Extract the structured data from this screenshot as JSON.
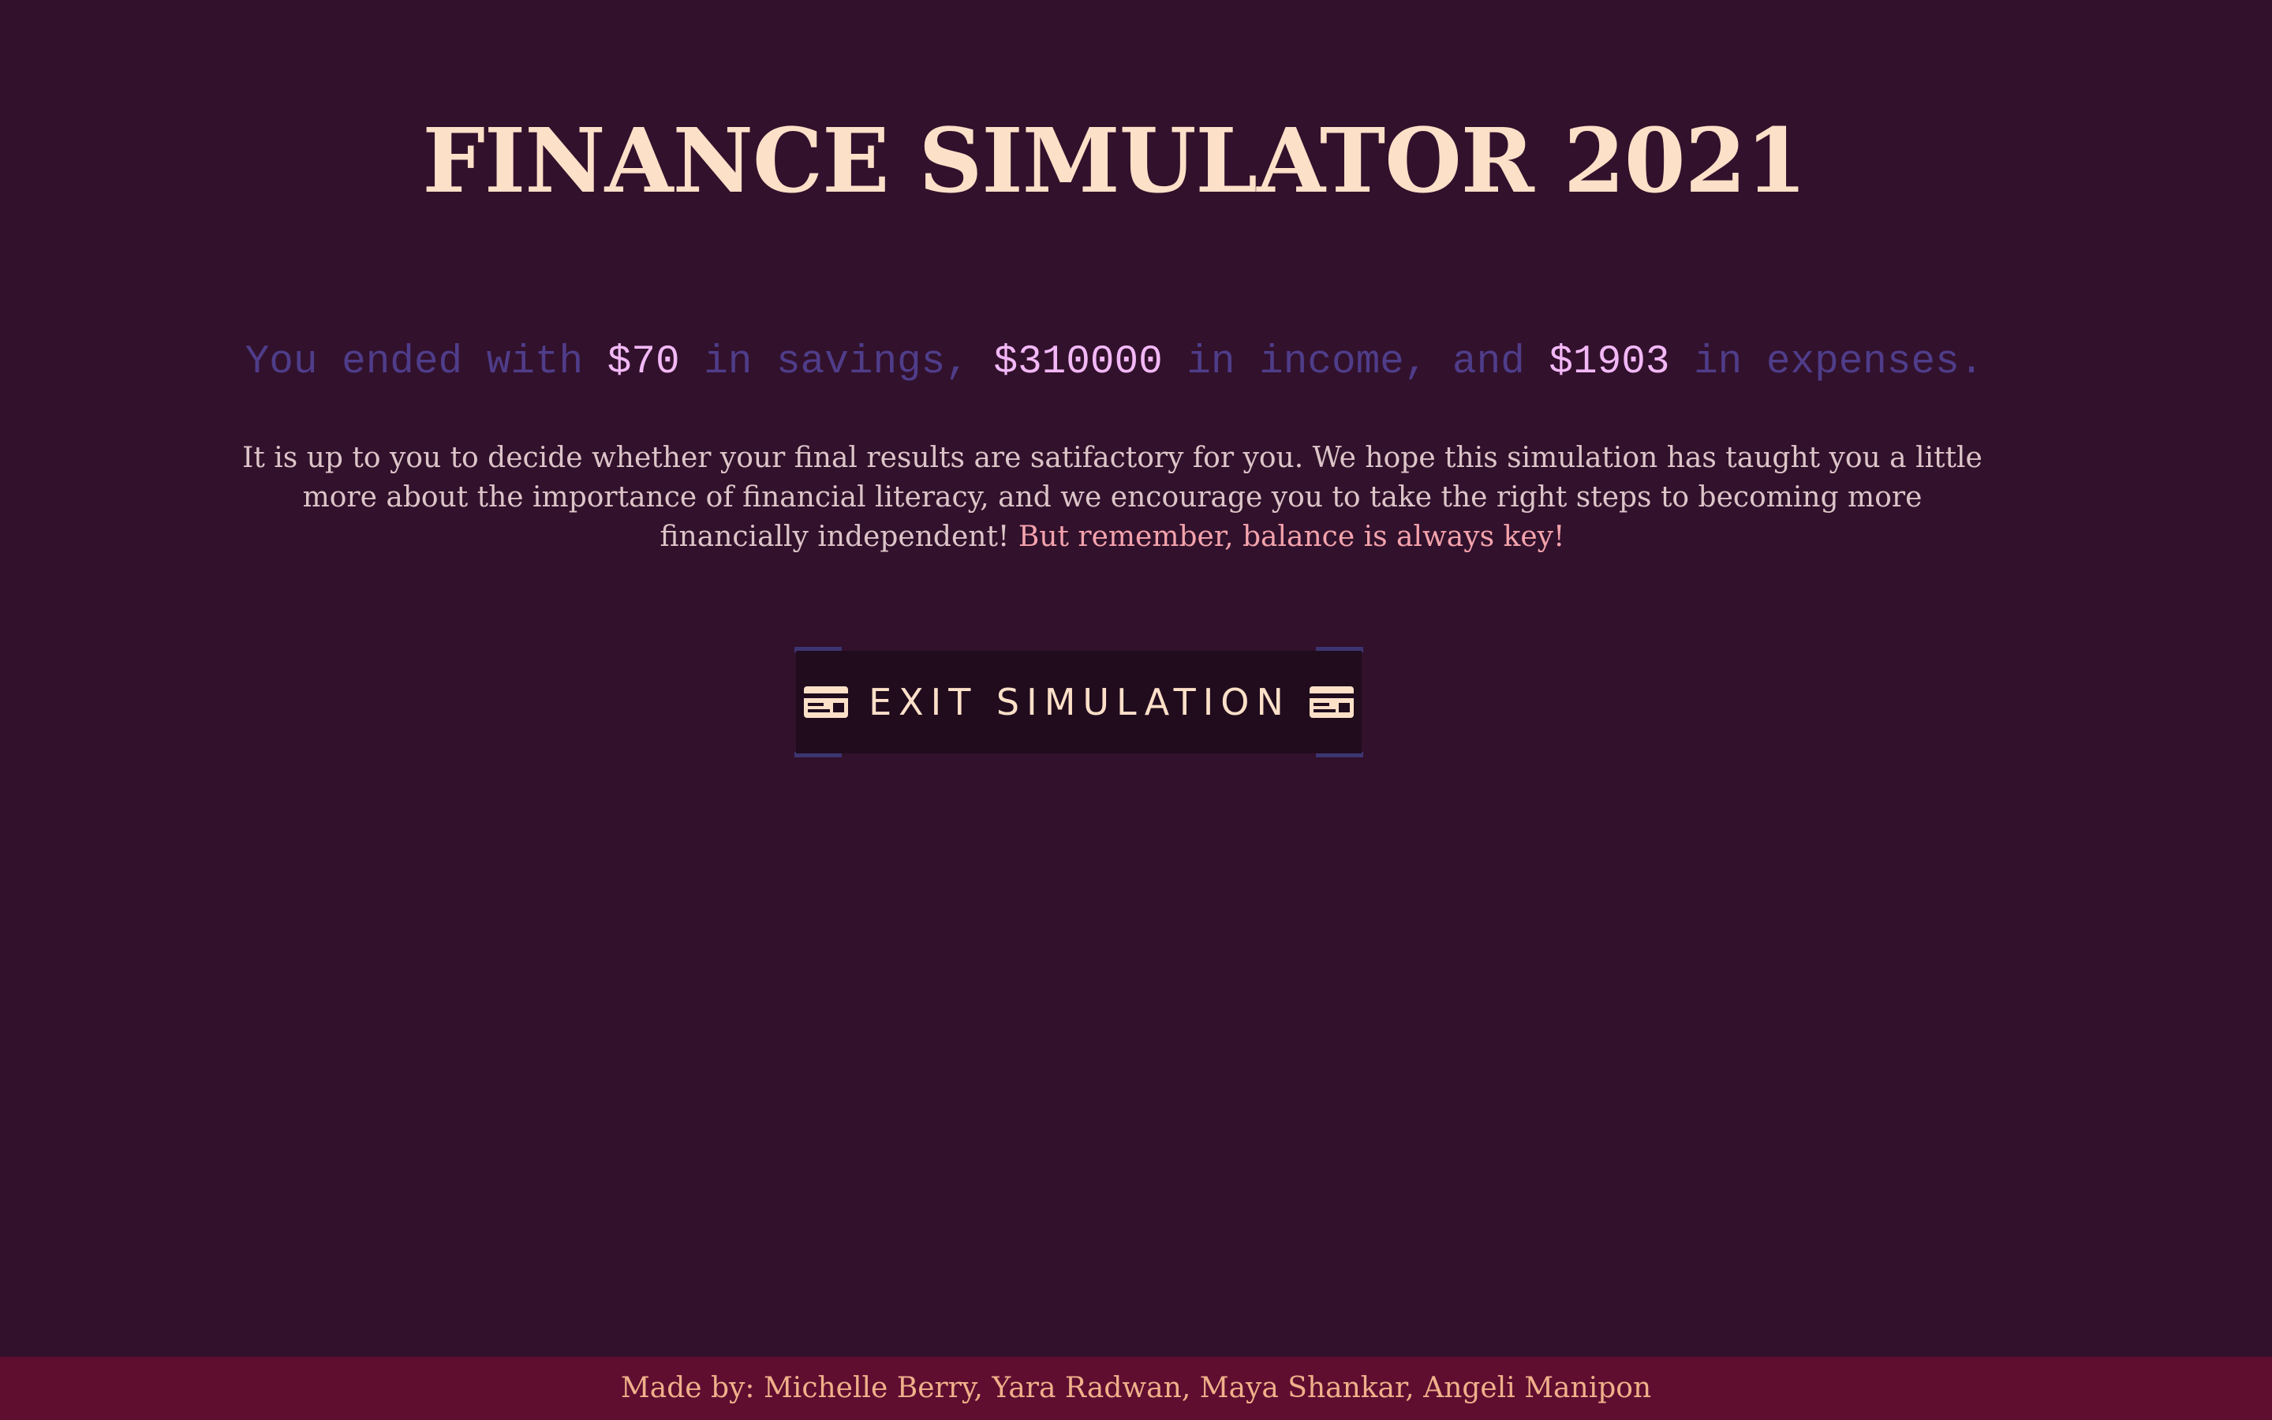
{
  "header": {
    "title": "FINANCE SIMULATOR 2021"
  },
  "summary": {
    "prefix": "You ended with",
    "savings": "$70",
    "savings_suffix": "in savings,",
    "income": "$310000",
    "income_suffix": "in income, and",
    "expenses": "$1903",
    "expenses_suffix": "in expenses."
  },
  "message": {
    "body": "It is up to you to decide whether your final results are satifactory for you. We hope this simulation has taught you a little more about the importance of financial literacy, and we encourage you to take the right steps to becoming more financially independent!",
    "accent": "But remember, balance is always key!"
  },
  "exit_button": {
    "label": "EXIT SIMULATION",
    "icon": "credit-card-icon"
  },
  "footer": {
    "credits": "Made by: Michelle Berry, Yara Radwan, Maya Shankar, Angeli Manipon"
  },
  "colors": {
    "background": "#32112c",
    "title": "#fde0c8",
    "summary_text": "#4f3d8a",
    "summary_values": "#f2b8f6",
    "message_text": "#dcc5c8",
    "message_accent": "#f4a3ac",
    "button_bg": "#210c1e",
    "button_brackets": "#3c3572",
    "footer_bg": "#5f0e30",
    "footer_text": "#f0b08a"
  }
}
